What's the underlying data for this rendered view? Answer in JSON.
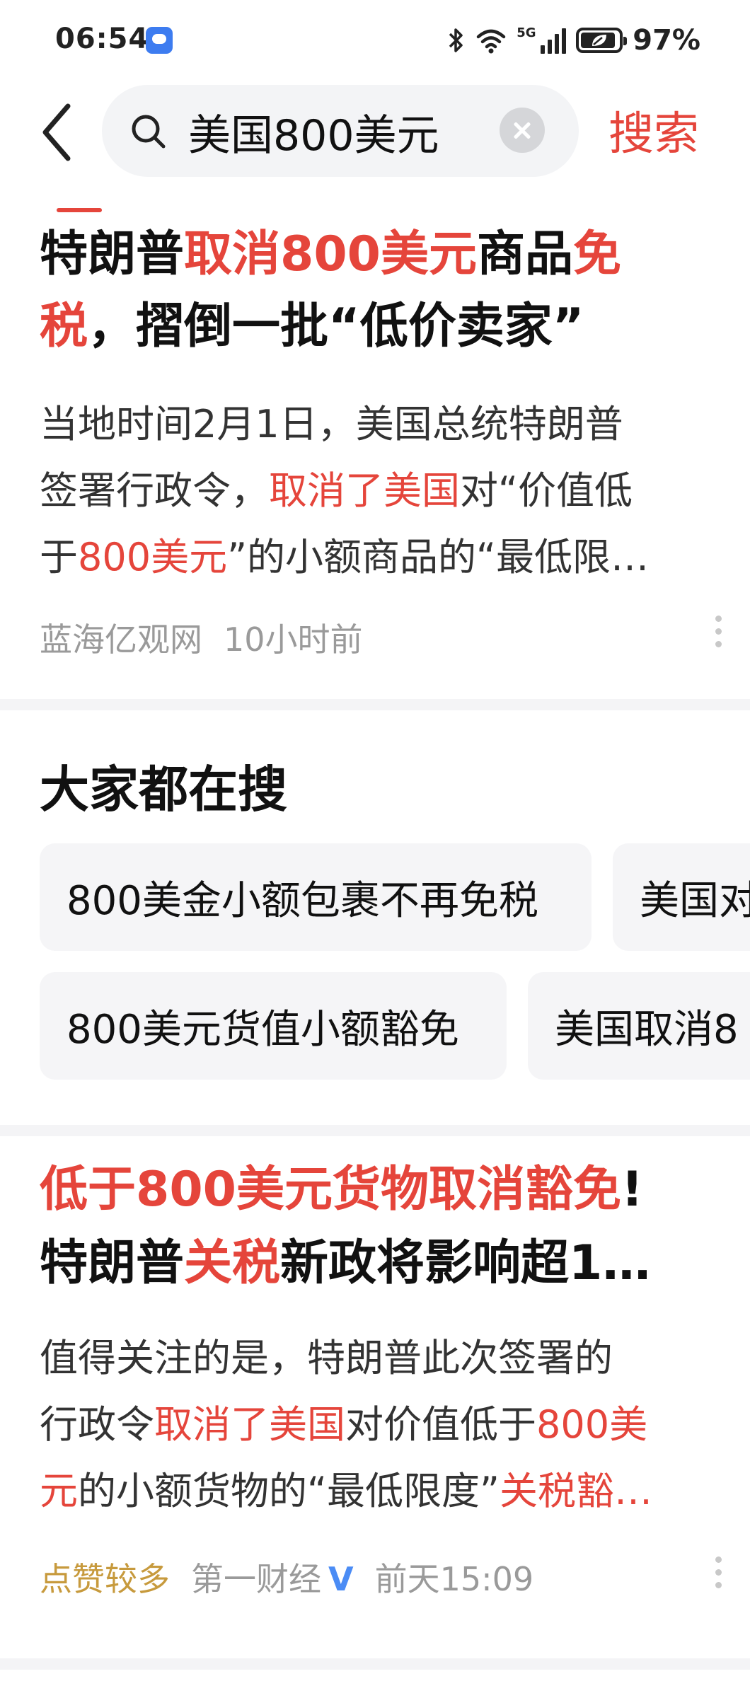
{
  "status_bar": {
    "time": "06:54",
    "network": "5G",
    "battery": "97%",
    "icons": [
      "message-icon",
      "bluetooth-icon",
      "wifi-icon",
      "signal-icon",
      "battery-leaf-icon"
    ]
  },
  "search": {
    "query": "美国800美元",
    "button_label": "搜索",
    "icons": [
      "back-arrow-icon",
      "search-icon",
      "clear-icon"
    ]
  },
  "articles": [
    {
      "title_lines": [
        [
          {
            "t": "特朗普",
            "h": false
          },
          {
            "t": "取消800美元",
            "h": true
          },
          {
            "t": "商品",
            "h": false
          },
          {
            "t": "免",
            "h": true
          }
        ],
        [
          {
            "t": "税",
            "h": true
          },
          {
            "t": "，摺倒一批“低价卖家”",
            "h": false
          }
        ]
      ],
      "body_lines": [
        [
          {
            "t": "当地时间2月1日，美国总统特朗普",
            "h": false
          }
        ],
        [
          {
            "t": "签署行政令，",
            "h": false
          },
          {
            "t": "取消了美国",
            "h": true
          },
          {
            "t": "对“价值低",
            "h": false
          }
        ],
        [
          {
            "t": "于",
            "h": false
          },
          {
            "t": "800美元",
            "h": true
          },
          {
            "t": "”的小额商品的“最低限…",
            "h": false
          }
        ]
      ],
      "source": "蓝海亿观网",
      "time": "10小时前"
    },
    {
      "title_lines": [
        [
          {
            "t": "低于800美元货物取消豁免",
            "h": true
          },
          {
            "t": "!",
            "h": false
          }
        ],
        [
          {
            "t": "特朗普",
            "h": false
          },
          {
            "t": "关税",
            "h": true
          },
          {
            "t": "新政将影响超1…",
            "h": false
          }
        ]
      ],
      "body_lines": [
        [
          {
            "t": "值得关注的是，特朗普此次签署的",
            "h": false
          }
        ],
        [
          {
            "t": "行政令",
            "h": false
          },
          {
            "t": "取消了美国",
            "h": true
          },
          {
            "t": "对价值低于",
            "h": false
          },
          {
            "t": "800美",
            "h": true
          }
        ],
        [
          {
            "t": "元",
            "h": true
          },
          {
            "t": "的小额货物的“最低限度”",
            "h": false
          },
          {
            "t": "关税豁…",
            "h": true
          }
        ]
      ],
      "tag": "点赞较多",
      "source": "第一财经",
      "verified_mark": "V",
      "time": "前天15:09"
    }
  ],
  "hot_searches": {
    "title": "大家都在搜",
    "rows": [
      [
        "800美金小额包裹不再免税",
        "美国对"
      ],
      [
        "800美元货值小额豁免",
        "美国取消8"
      ]
    ]
  },
  "colors": {
    "accent": "#e5453b",
    "tag": "#c79a3d",
    "verified": "#4b8cf5",
    "muted": "#9a9a9a"
  }
}
